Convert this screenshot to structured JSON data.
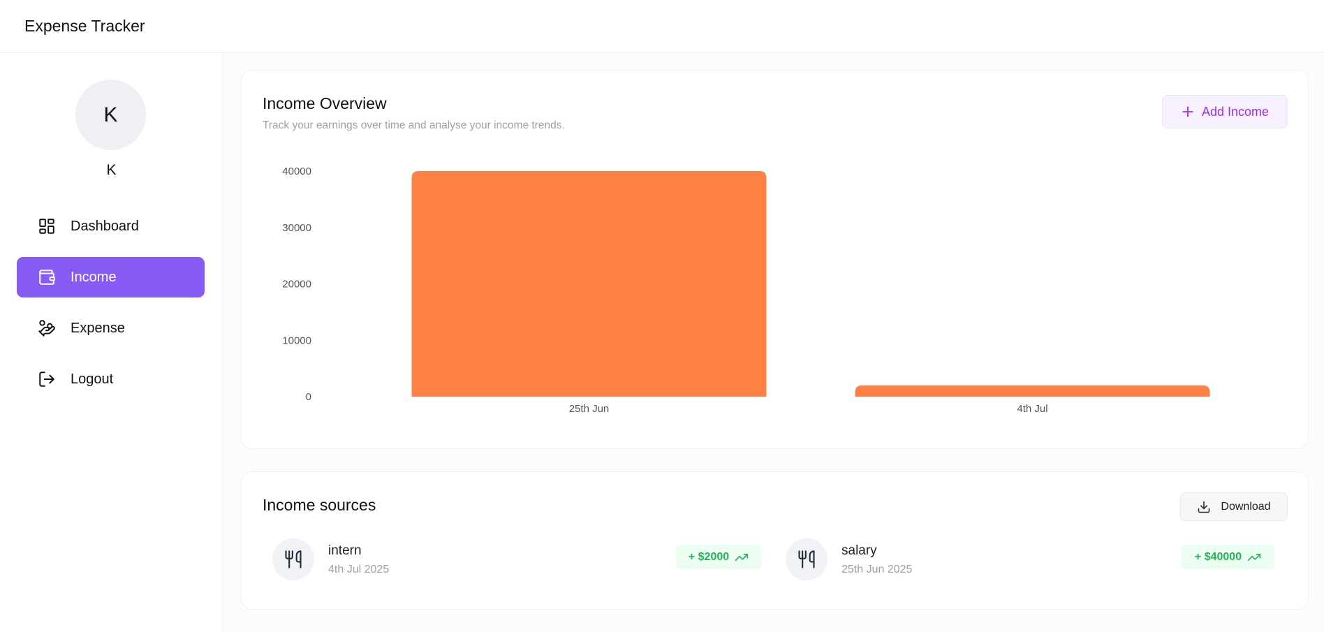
{
  "app": {
    "title": "Expense Tracker"
  },
  "user": {
    "initial": "K",
    "name": "K"
  },
  "sidebar": {
    "items": [
      {
        "label": "Dashboard",
        "icon": "dashboard-icon"
      },
      {
        "label": "Income",
        "icon": "wallet-icon",
        "active": true
      },
      {
        "label": "Expense",
        "icon": "hand-coins-icon"
      },
      {
        "label": "Logout",
        "icon": "logout-icon"
      }
    ]
  },
  "overview": {
    "title": "Income Overview",
    "subtitle": "Track your earnings over time and analyse your income trends.",
    "add_button_label": "Add Income"
  },
  "chart_data": {
    "type": "bar",
    "categories": [
      "25th Jun",
      "4th Jul"
    ],
    "values": [
      40000,
      2000
    ],
    "yticks": [
      0,
      10000,
      20000,
      30000,
      40000
    ],
    "ylim": [
      0,
      40000
    ],
    "color": "#ff8042",
    "grid": false
  },
  "sources": {
    "title": "Income sources",
    "download_label": "Download",
    "items": [
      {
        "name": "intern",
        "date": "4th Jul 2025",
        "amount": "+ $2000",
        "icon": "utensils-icon"
      },
      {
        "name": "salary",
        "date": "25th Jun 2025",
        "amount": "+ $40000",
        "icon": "utensils-icon"
      }
    ]
  },
  "colors": {
    "accent": "#875cf5",
    "bar": "#ff8042",
    "positive": "#22b45b",
    "positive_bg": "#ecfdf2"
  }
}
